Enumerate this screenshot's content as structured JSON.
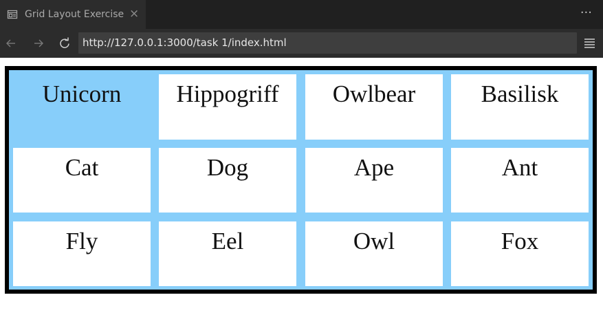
{
  "tab": {
    "title": "Grid Layout Exercise",
    "close_glyph": "×",
    "icon": "browser-tab-icon"
  },
  "toolbar": {
    "back_icon": "arrow-left-icon",
    "forward_icon": "arrow-right-icon",
    "reload_icon": "reload-icon",
    "url": "http://127.0.0.1:3000/task 1/index.html",
    "menu_icon": "hamburger-menu-icon",
    "more_glyph": "···"
  },
  "colors": {
    "grid_background": "#87cefa",
    "grid_border": "#000000",
    "cell_background": "#ffffff",
    "chrome_dark": "#202020",
    "chrome_mid": "#2c2c2c"
  },
  "grid": {
    "cells": [
      {
        "label": "Unicorn",
        "highlighted": true
      },
      {
        "label": "Hippogriff",
        "highlighted": false
      },
      {
        "label": "Owlbear",
        "highlighted": false
      },
      {
        "label": "Basilisk",
        "highlighted": false
      },
      {
        "label": "Cat",
        "highlighted": false
      },
      {
        "label": "Dog",
        "highlighted": false
      },
      {
        "label": "Ape",
        "highlighted": false
      },
      {
        "label": "Ant",
        "highlighted": false
      },
      {
        "label": "Fly",
        "highlighted": false
      },
      {
        "label": "Eel",
        "highlighted": false
      },
      {
        "label": "Owl",
        "highlighted": false
      },
      {
        "label": "Fox",
        "highlighted": false
      }
    ]
  }
}
